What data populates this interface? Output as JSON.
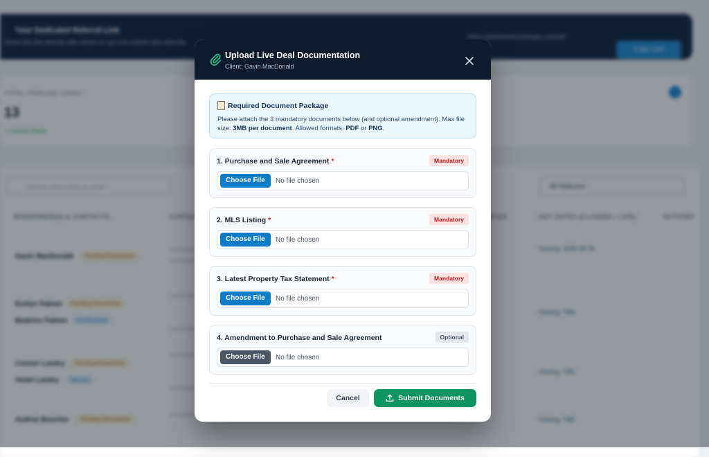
{
  "background": {
    "referral": {
      "title": "Your Dedicated Referral Link",
      "subtitle": "Share this link directly with clients or use it to submit new referrals",
      "link": "https://dashboard.example.com/ref/",
      "copy_label": "Copy Link"
    },
    "stats": {
      "label": "TOTAL PIPELINE LEADS",
      "value": "13",
      "note": "+ Closed Deals"
    },
    "table": {
      "search_placeholder": "Search client name or email...",
      "status_filter": "All Statuses",
      "headers": [
        "BORROWER(S) & CONTACTS",
        "CONTACT",
        "DATES",
        "KEY DATES (CLOSING / LIVE)",
        "ACTIONS"
      ],
      "rows": [
        {
          "name": "Gavin MacDonald",
          "badge": "Pending Documents",
          "closing": "Closing: 2026-08-30"
        },
        {
          "name": "Evelyn Palmer",
          "badge": "Pending Documents",
          "name2": "Beatrice Palmer",
          "badge2": "Co-Borrower",
          "closing": "Closing: TBD"
        },
        {
          "name": "Connor Landry",
          "badge": "Pending Documents",
          "name2": "Violet Landry",
          "badge2": "Spouse",
          "closing": "Closing: TBD"
        },
        {
          "name": "Audrey Boucher",
          "badge": "Pending Documents",
          "closing": "Closing: TBD"
        }
      ]
    }
  },
  "modal": {
    "title": "Upload Live Deal Documentation",
    "client": "Client: Gavin MacDonald",
    "info": {
      "title": "Required Document Package",
      "text_a": "Please attach the 3 mandatory documents below (and optional amendment). Max file size: ",
      "size": "3MB per document",
      "text_b": ". Allowed formats: ",
      "fmt1": "PDF",
      "or": " or ",
      "fmt2": "PNG",
      "end": "."
    },
    "documents": [
      {
        "label": "1. Purchase and Sale Agreement",
        "required": "*",
        "badge": "Mandatory",
        "button": "Choose File",
        "status": "No file chosen"
      },
      {
        "label": "2. MLS Listing",
        "required": "*",
        "badge": "Mandatory",
        "button": "Choose File",
        "status": "No file chosen"
      },
      {
        "label": "3. Latest Property Tax Statement",
        "required": "*",
        "badge": "Mandatory",
        "button": "Choose File",
        "status": "No file chosen"
      },
      {
        "label": "4. Amendment to Purchase and Sale Agreement",
        "required": "",
        "badge": "Optional",
        "button": "Choose File",
        "status": "No file chosen"
      }
    ],
    "cancel_label": "Cancel",
    "submit_label": "Submit Documents"
  },
  "colors": {
    "header": "#0f1c2e",
    "primary": "#0f7cc7",
    "success": "#0d9462",
    "danger": "#dc2626"
  }
}
